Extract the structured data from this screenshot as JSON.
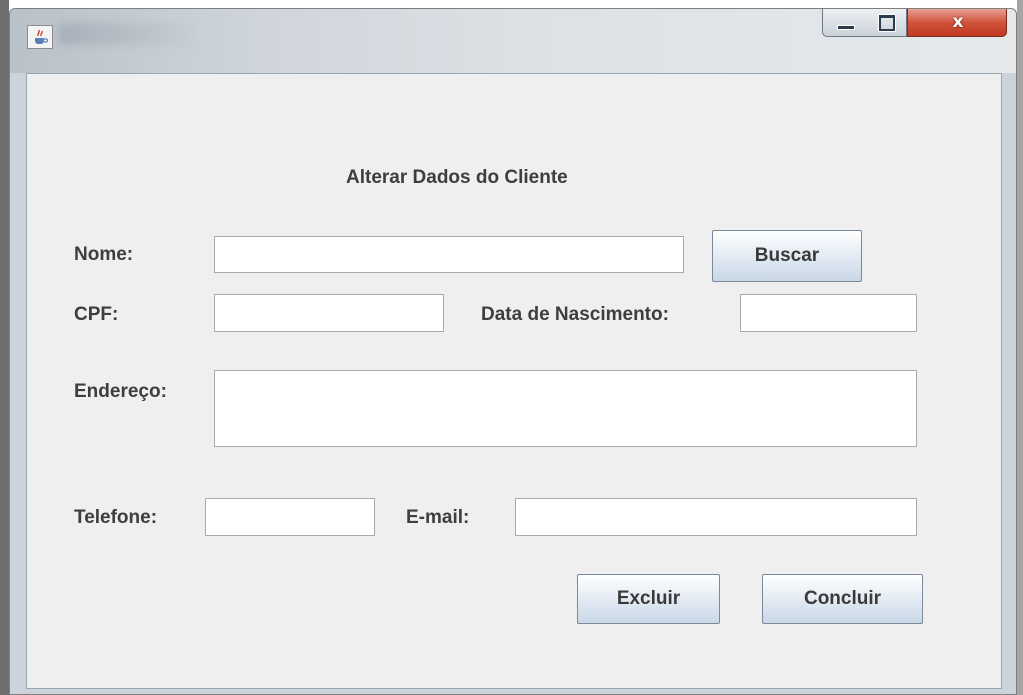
{
  "window": {
    "title": ""
  },
  "form": {
    "heading": "Alterar Dados do Cliente",
    "nome_label": "Nome:",
    "nome_value": "",
    "buscar_button": "Buscar",
    "cpf_label": "CPF:",
    "cpf_value": "",
    "nascimento_label": "Data de Nascimento:",
    "nascimento_value": "",
    "endereco_label": "Endereço:",
    "endereco_value": "",
    "telefone_label": "Telefone:",
    "telefone_value": "",
    "email_label": "E-mail:",
    "email_value": "",
    "excluir_button": "Excluir",
    "concluir_button": "Concluir"
  },
  "icons": {
    "app": "java-coffee-icon",
    "minimize": "minimize-icon",
    "maximize": "maximize-icon",
    "close": "close-icon"
  },
  "colors": {
    "panel_background": "#efefef",
    "label_text": "#3e3e3e",
    "close_button": "#c94a33"
  }
}
